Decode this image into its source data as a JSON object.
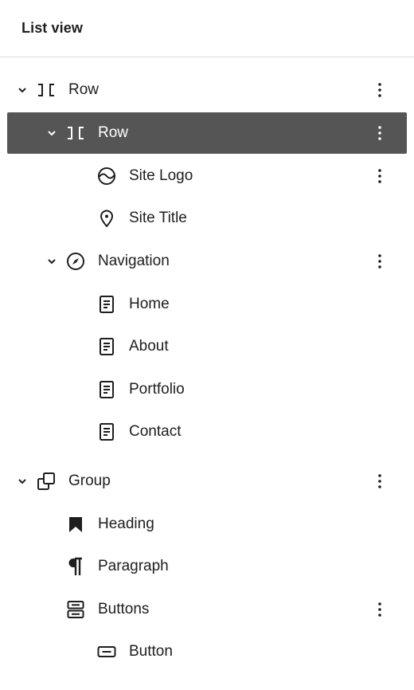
{
  "header": {
    "title": "List view"
  },
  "tree": {
    "row_outer": {
      "label": "Row"
    },
    "row_inner": {
      "label": "Row"
    },
    "site_logo": {
      "label": "Site Logo"
    },
    "site_title": {
      "label": "Site Title"
    },
    "navigation": {
      "label": "Navigation"
    },
    "nav_home": {
      "label": "Home"
    },
    "nav_about": {
      "label": "About"
    },
    "nav_portfolio": {
      "label": "Portfolio"
    },
    "nav_contact": {
      "label": "Contact"
    },
    "group": {
      "label": "Group"
    },
    "heading": {
      "label": "Heading"
    },
    "paragraph": {
      "label": "Paragraph"
    },
    "buttons": {
      "label": "Buttons"
    },
    "button": {
      "label": "Button"
    }
  },
  "icons": {
    "row": "row-icon",
    "site_logo": "site-logo-icon",
    "site_title": "map-marker-icon",
    "navigation": "compass-icon",
    "page": "page-icon",
    "group": "group-icon",
    "heading": "bookmark-icon",
    "paragraph": "pilcrow-icon",
    "buttons": "buttons-icon",
    "button": "button-icon",
    "more": "more-vertical-icon",
    "chevron": "chevron-down-icon"
  },
  "colors": {
    "selected_bg": "#555555",
    "selected_text": "#ffffff",
    "text": "#1e1e1e",
    "divider": "#dcdcde"
  }
}
